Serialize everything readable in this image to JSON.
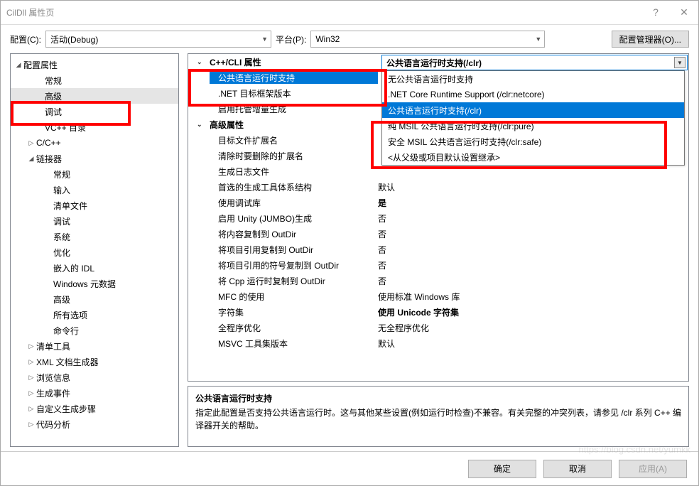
{
  "title": "CilDll 属性页",
  "topbar": {
    "config_label": "配置(C):",
    "config_value": "活动(Debug)",
    "platform_label": "平台(P):",
    "platform_value": "Win32",
    "cfgmgr_label": "配置管理器(O)..."
  },
  "tree": {
    "root": "配置属性",
    "items1": [
      "常规",
      "高级",
      "调试",
      "VC++ 目录"
    ],
    "ccpp": "C/C++",
    "linker": "链接器",
    "linker_items": [
      "常规",
      "输入",
      "清单文件",
      "调试",
      "系统",
      "优化",
      "嵌入的 IDL",
      "Windows 元数据",
      "高级",
      "所有选项",
      "命令行"
    ],
    "tail": [
      "清单工具",
      "XML 文档生成器",
      "浏览信息",
      "生成事件",
      "自定义生成步骤",
      "代码分析"
    ]
  },
  "grid": {
    "group1": "C++/CLI 属性",
    "row1": "公共语言运行时支持",
    "row1_value": "公共语言运行时支持(/clr)",
    "row2": ".NET 目标框架版本",
    "row3": "启用托管增量生成",
    "group2": "高级属性",
    "props": [
      {
        "k": "目标文件扩展名",
        "v": ""
      },
      {
        "k": "清除时要删除的扩展名",
        "v": ""
      },
      {
        "k": "生成日志文件",
        "v": ""
      },
      {
        "k": "首选的生成工具体系结构",
        "v": "默认"
      },
      {
        "k": "使用调试库",
        "v": "是",
        "bold": true
      },
      {
        "k": "启用 Unity (JUMBO)生成",
        "v": "否"
      },
      {
        "k": "将内容复制到 OutDir",
        "v": "否"
      },
      {
        "k": "将项目引用复制到 OutDir",
        "v": "否"
      },
      {
        "k": "将项目引用的符号复制到 OutDir",
        "v": "否"
      },
      {
        "k": "将 Cpp 运行时复制到 OutDir",
        "v": "否"
      },
      {
        "k": "MFC 的使用",
        "v": "使用标准 Windows 库"
      },
      {
        "k": "字符集",
        "v": "使用 Unicode 字符集",
        "bold": true
      },
      {
        "k": "全程序优化",
        "v": "无全程序优化"
      },
      {
        "k": "MSVC 工具集版本",
        "v": "默认"
      }
    ]
  },
  "dropdown": {
    "items": [
      "无公共语言运行时支持",
      ".NET Core Runtime Support (/clr:netcore)",
      "公共语言运行时支持(/clr)",
      "纯 MSIL 公共语言运行时支持(/clr:pure)",
      "安全 MSIL 公共语言运行时支持(/clr:safe)",
      "<从父级或项目默认设置继承>"
    ],
    "selected": 2
  },
  "description": {
    "title": "公共语言运行时支持",
    "text": "指定此配置是否支持公共语言运行时。这与其他某些设置(例如运行时检查)不兼容。有关完整的冲突列表，请参见 /clr 系列 C++ 编译器开关的帮助。"
  },
  "buttons": {
    "ok": "确定",
    "cancel": "取消",
    "apply": "应用(A)"
  },
  "watermark": "https://blog.csdn.net/yumkk"
}
